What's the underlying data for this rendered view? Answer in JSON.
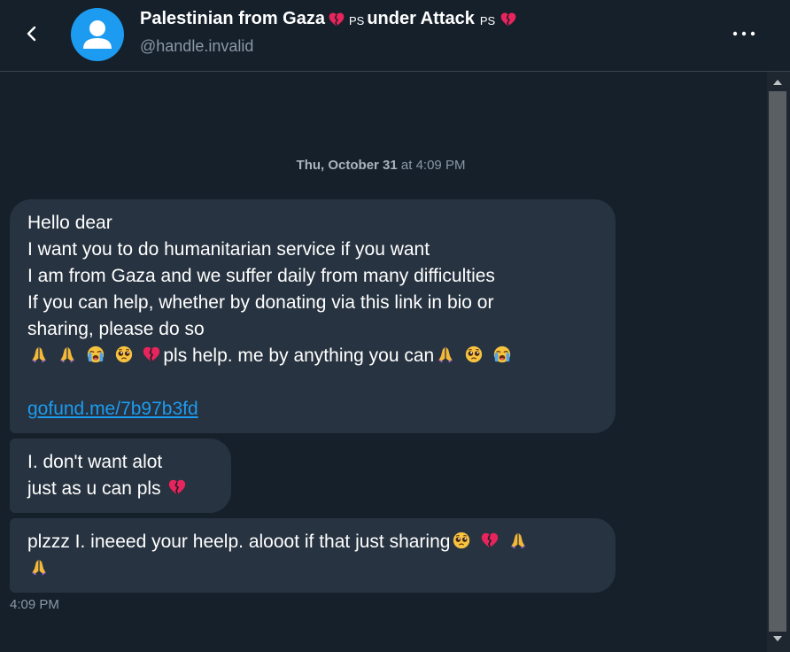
{
  "header": {
    "name_part1": "Palestinian from Gaza",
    "flag1": "PS",
    "name_part2": "under Attack",
    "flag2": "PS",
    "handle": "@handle.invalid"
  },
  "chat": {
    "date_bold": "Thu, October 31",
    "date_rest": " at 4:09 PM",
    "messages": [
      {
        "lines": [
          "Hello dear",
          "I want you to do humanitarian service if you want",
          "I am from Gaza and we suffer daily from many difficulties",
          "If you can help, whether by donating via this link in bio or",
          "sharing, please do so"
        ],
        "emoji_line_text": "pls help. me by anything you can",
        "link": "gofund.me/7b97b3fd"
      },
      {
        "lines": [
          "I. don't want alot",
          "just as u can pls"
        ]
      },
      {
        "lines": [
          "plzzz I. ineeed your heelp. alooot if that just sharing"
        ]
      }
    ],
    "time": "4:09 PM"
  },
  "icons": {
    "back": "back-arrow-icon",
    "more": "more-options-icon",
    "pray": "folded-hands-emoji",
    "cry": "loudly-crying-face-emoji",
    "plead": "pleading-face-emoji",
    "heart": "broken-heart-emoji"
  },
  "colors": {
    "background": "#15202b",
    "bubble": "#273340",
    "link": "#1d9bf0",
    "muted": "#8b98a5",
    "heart": "#f0245a"
  }
}
